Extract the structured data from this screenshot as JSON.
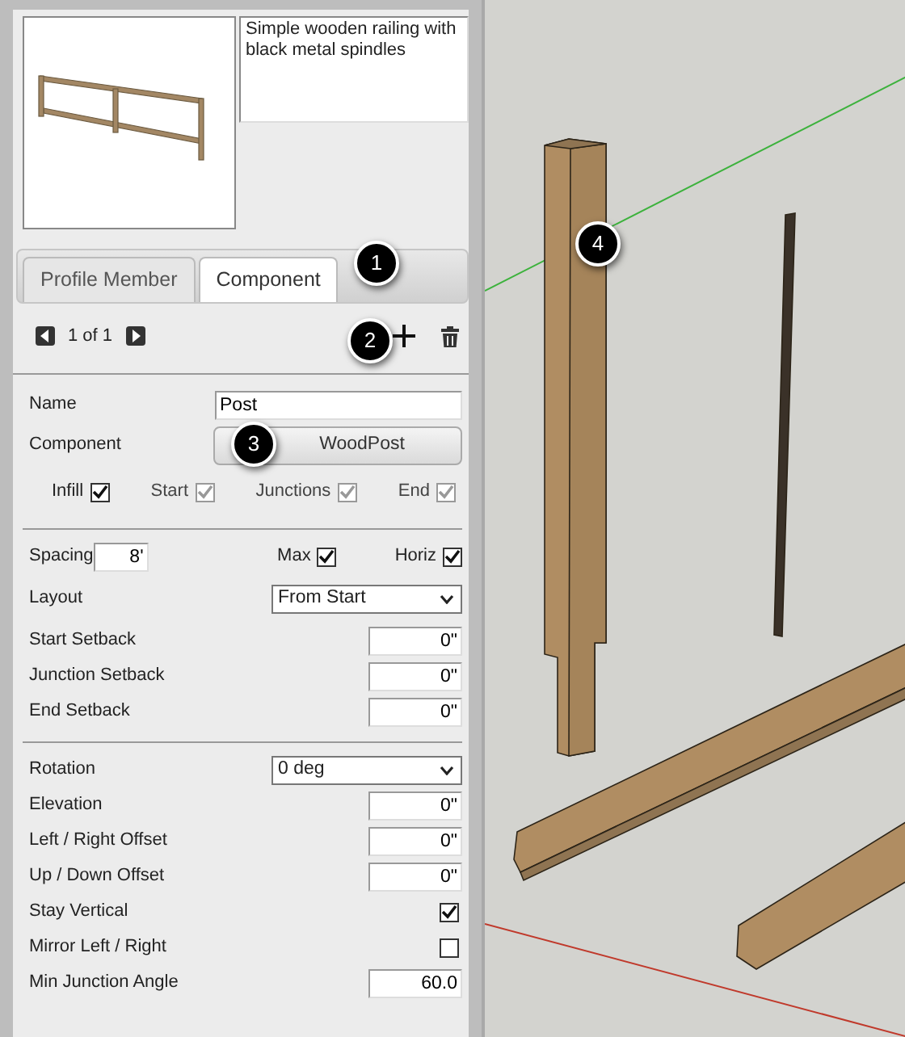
{
  "preview": {
    "description": "Simple wooden railing with black metal spindles"
  },
  "tabs": [
    {
      "label": "Profile Member",
      "selected": false
    },
    {
      "label": "Component",
      "selected": true
    }
  ],
  "pager": {
    "text": "1 of 1"
  },
  "name": {
    "label": "Name",
    "value": "Post"
  },
  "component": {
    "label": "Component",
    "button": "WoodPost"
  },
  "placement": [
    {
      "label": "Infill",
      "checked": true,
      "disabled": false
    },
    {
      "label": "Start",
      "checked": true,
      "disabled": true
    },
    {
      "label": "Junctions",
      "checked": true,
      "disabled": true
    },
    {
      "label": "End",
      "checked": true,
      "disabled": true
    }
  ],
  "spacing": {
    "label": "Spacing",
    "value": "8'"
  },
  "spacing_options": [
    {
      "label": "Max",
      "checked": true
    },
    {
      "label": "Horiz",
      "checked": true
    }
  ],
  "layout": {
    "label": "Layout",
    "value": "From Start"
  },
  "setbacks": [
    {
      "label": "Start Setback",
      "value": "0\""
    },
    {
      "label": "Junction Setback",
      "value": "0\""
    },
    {
      "label": "End Setback",
      "value": "0\""
    }
  ],
  "settings": [
    {
      "kind": "select",
      "label": "Rotation",
      "value": "0 deg"
    },
    {
      "kind": "input",
      "label": "Elevation",
      "value": "0\""
    },
    {
      "kind": "input",
      "label": "Left / Right Offset",
      "value": "0\""
    },
    {
      "kind": "input",
      "label": "Up / Down Offset",
      "value": "0\""
    },
    {
      "kind": "check",
      "label": "Stay Vertical",
      "checked": true
    },
    {
      "kind": "check",
      "label": "Mirror Left / Right",
      "checked": false
    },
    {
      "kind": "input",
      "label": "Min Junction Angle",
      "value": "60.0"
    }
  ],
  "callouts": [
    "1",
    "2",
    "3",
    "4"
  ]
}
